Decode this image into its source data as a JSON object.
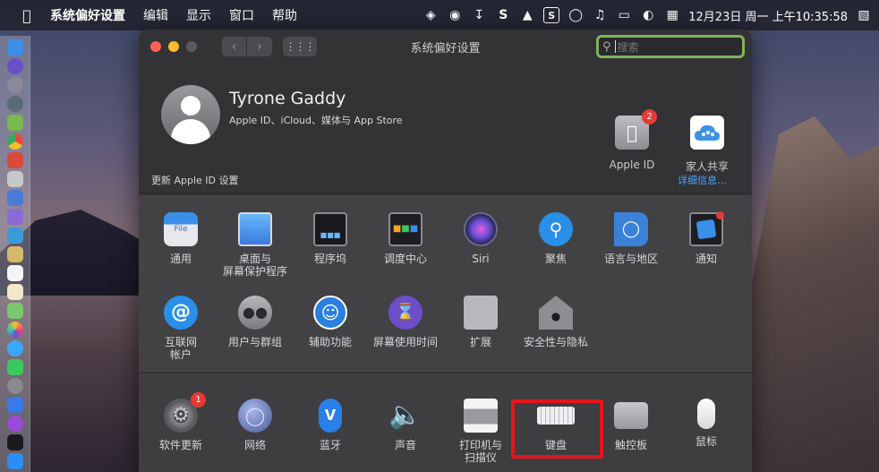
{
  "menubar": {
    "apple_icon": "apple-logo-icon",
    "app_name": "系统偏好设置",
    "menus": [
      "编辑",
      "显示",
      "窗口",
      "帮助"
    ],
    "status_icons": [
      "fox-icon",
      "record-icon",
      "download-icon",
      "s-icon",
      "ghost-icon",
      "s-box-icon",
      "globe-icon",
      "music-icon",
      "display-icon",
      "speed-icon",
      "calendar-icon"
    ],
    "clock": "12月23日 周一 上午10:35:58",
    "control_icon": "control-center-icon"
  },
  "window": {
    "title": "系统偏好设置",
    "back_glyph": "‹",
    "forward_glyph": "›",
    "grid_glyph": "⋮⋮⋮",
    "search_placeholder": "搜索",
    "search_glyph": "🔍"
  },
  "account": {
    "name": "Tyrone Gaddy",
    "subtitle": "Apple ID、iCloud、媒体与 App Store",
    "apple_id": {
      "label": "Apple ID",
      "badge": "2"
    },
    "family": {
      "label": "家人共享"
    }
  },
  "notice": {
    "text": "更新 Apple ID 设置",
    "link": "详细信息…"
  },
  "row1": [
    {
      "label": "通用",
      "icon": "file-general-icon",
      "color": "#5a9fd6"
    },
    {
      "label": "桌面与\n屏幕保护程序",
      "icon": "desktop-icon",
      "color": "#3a8fe0"
    },
    {
      "label": "程序坞",
      "icon": "dock-icon",
      "color": "#2a2a2e"
    },
    {
      "label": "调度中心",
      "icon": "mission-control-icon",
      "color": "#2e2e32"
    },
    {
      "label": "Siri",
      "icon": "siri-icon",
      "color": "#20203a"
    },
    {
      "label": "聚焦",
      "icon": "spotlight-icon",
      "color": "#2a8fe8"
    },
    {
      "label": "语言与地区",
      "icon": "flag-globe-icon",
      "color": "#3a82d8"
    },
    {
      "label": "通知",
      "icon": "notification-icon",
      "color": "#2e2e34"
    }
  ],
  "row2": [
    {
      "label": "互联网\n帐户",
      "icon": "at-icon",
      "color": "#2a8fe8"
    },
    {
      "label": "用户与群组",
      "icon": "users-icon",
      "color": "#8a8a8e"
    },
    {
      "label": "辅助功能",
      "icon": "accessibility-icon",
      "color": "#2a7fe0"
    },
    {
      "label": "屏幕使用时间",
      "icon": "hourglass-icon",
      "color": "#6a4fc8"
    },
    {
      "label": "扩展",
      "icon": "puzzle-icon",
      "color": "#b8b8bc"
    },
    {
      "label": "安全性与隐私",
      "icon": "house-lock-icon",
      "color": "#8e8e92"
    }
  ],
  "row3": [
    {
      "label": "软件更新",
      "icon": "gear-icon",
      "color": "#6a6a6e",
      "badge": "1"
    },
    {
      "label": "网络",
      "icon": "network-globe-icon",
      "color": "#5a6a9a"
    },
    {
      "label": "蓝牙",
      "icon": "bluetooth-icon",
      "color": "#2a7fe8"
    },
    {
      "label": "声音",
      "icon": "speaker-icon",
      "color": "#5a5a5e"
    },
    {
      "label": "打印机与\n扫描仪",
      "icon": "printer-icon",
      "color": "#d8d8dc"
    },
    {
      "label": "键盘",
      "icon": "keyboard-icon",
      "color": "#d8d8dc"
    },
    {
      "label": "触控板",
      "icon": "trackpad-icon",
      "color": "#a8a8ac"
    },
    {
      "label": "鼠标",
      "icon": "mouse-icon",
      "color": "#e8e8ec"
    }
  ]
}
